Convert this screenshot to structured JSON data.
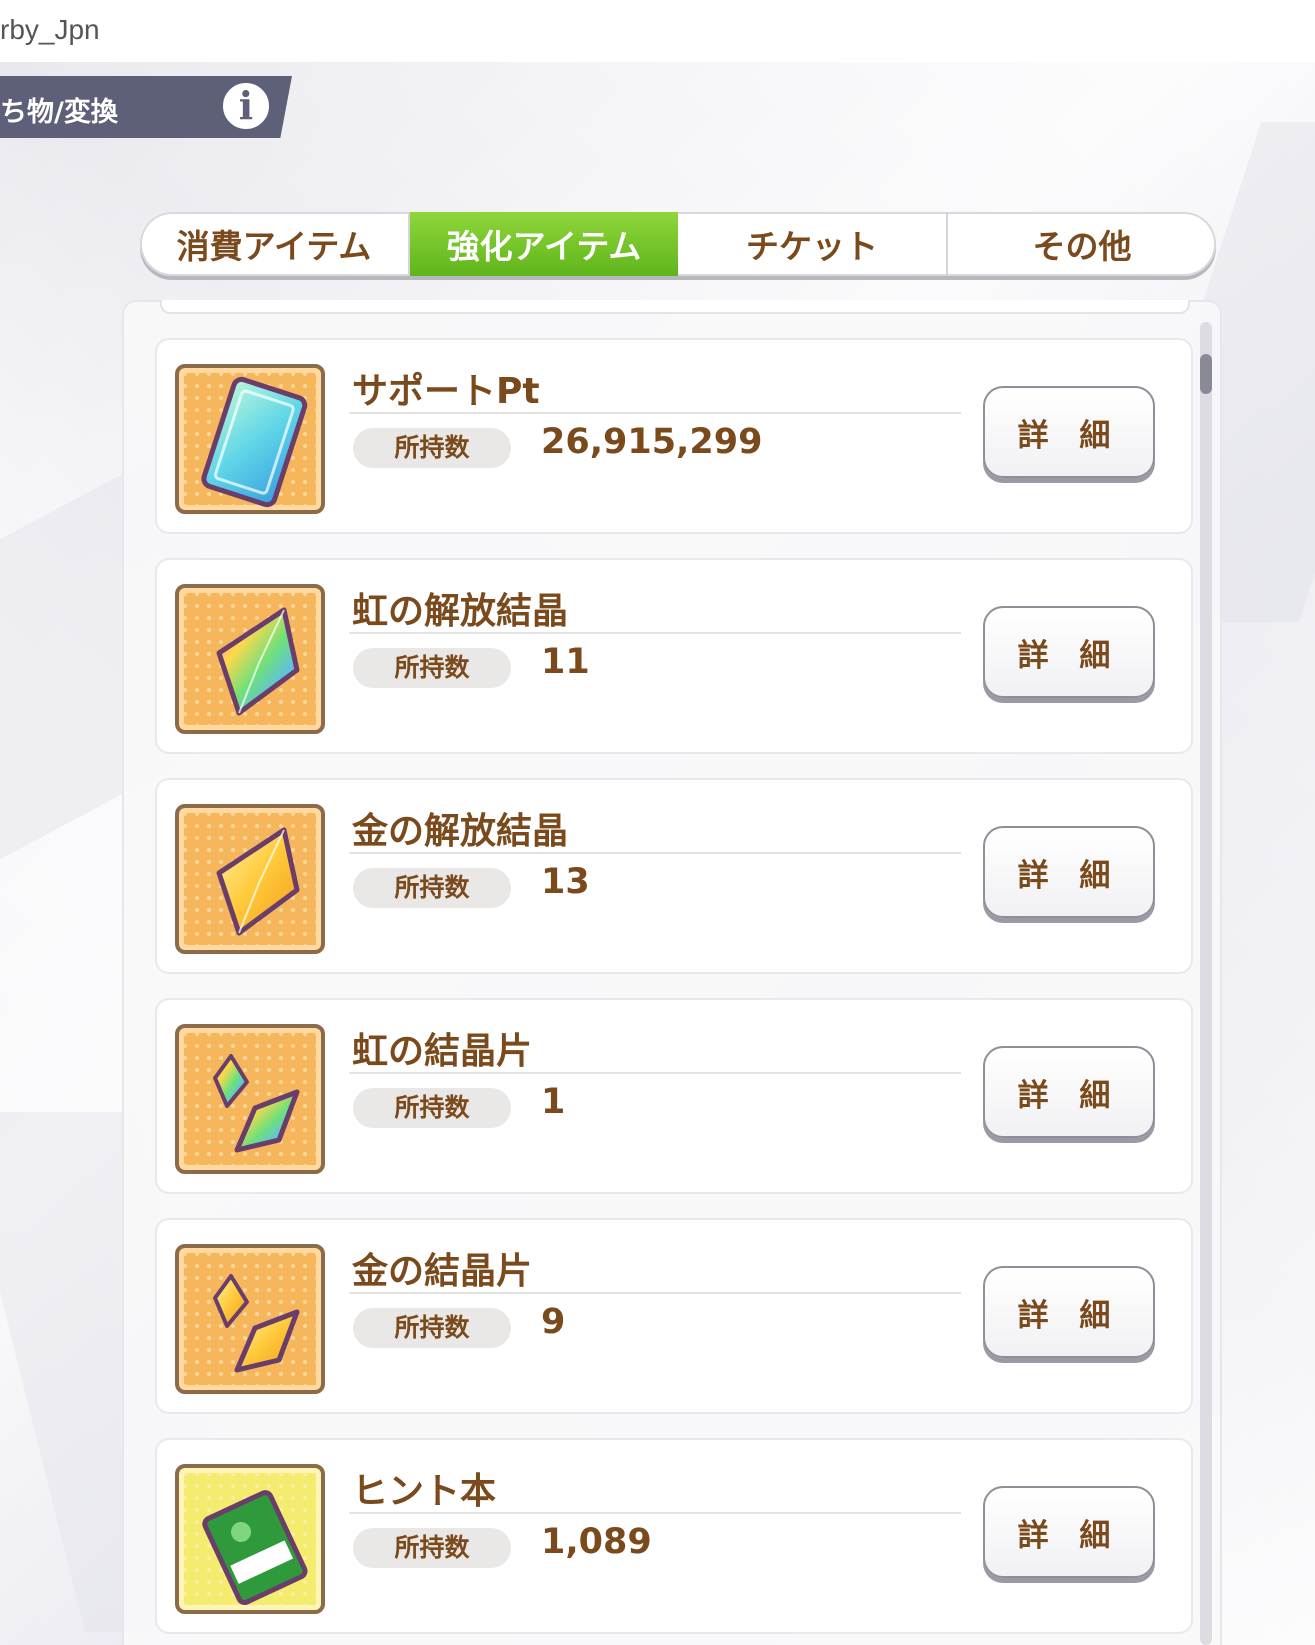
{
  "window": {
    "title": "rby_Jpn"
  },
  "header": {
    "title": "ち物/変換",
    "info_icon": "i"
  },
  "tabs": [
    {
      "label": "消費アイテム",
      "active": false
    },
    {
      "label": "強化アイテム",
      "active": true
    },
    {
      "label": "チケット",
      "active": false
    },
    {
      "label": "その他",
      "active": false
    }
  ],
  "items": [
    {
      "name": "サポートPt",
      "qty_label": "所持数",
      "qty": "26,915,299",
      "detail_label": "詳 細",
      "icon": "support-pt-card-icon"
    },
    {
      "name": "虹の解放結晶",
      "qty_label": "所持数",
      "qty": "11",
      "detail_label": "詳 細",
      "icon": "rainbow-crystal-icon"
    },
    {
      "name": "金の解放結晶",
      "qty_label": "所持数",
      "qty": "13",
      "detail_label": "詳 細",
      "icon": "gold-crystal-icon"
    },
    {
      "name": "虹の結晶片",
      "qty_label": "所持数",
      "qty": "1",
      "detail_label": "詳 細",
      "icon": "rainbow-shard-icon"
    },
    {
      "name": "金の結晶片",
      "qty_label": "所持数",
      "qty": "9",
      "detail_label": "詳 細",
      "icon": "gold-shard-icon"
    },
    {
      "name": "ヒント本",
      "qty_label": "所持数",
      "qty": "1,089",
      "detail_label": "詳 細",
      "icon": "hint-book-icon"
    }
  ],
  "colors": {
    "text_brown": "#7a4a1c",
    "tab_active": "#6fc226",
    "header_bg": "#5e5f78"
  }
}
